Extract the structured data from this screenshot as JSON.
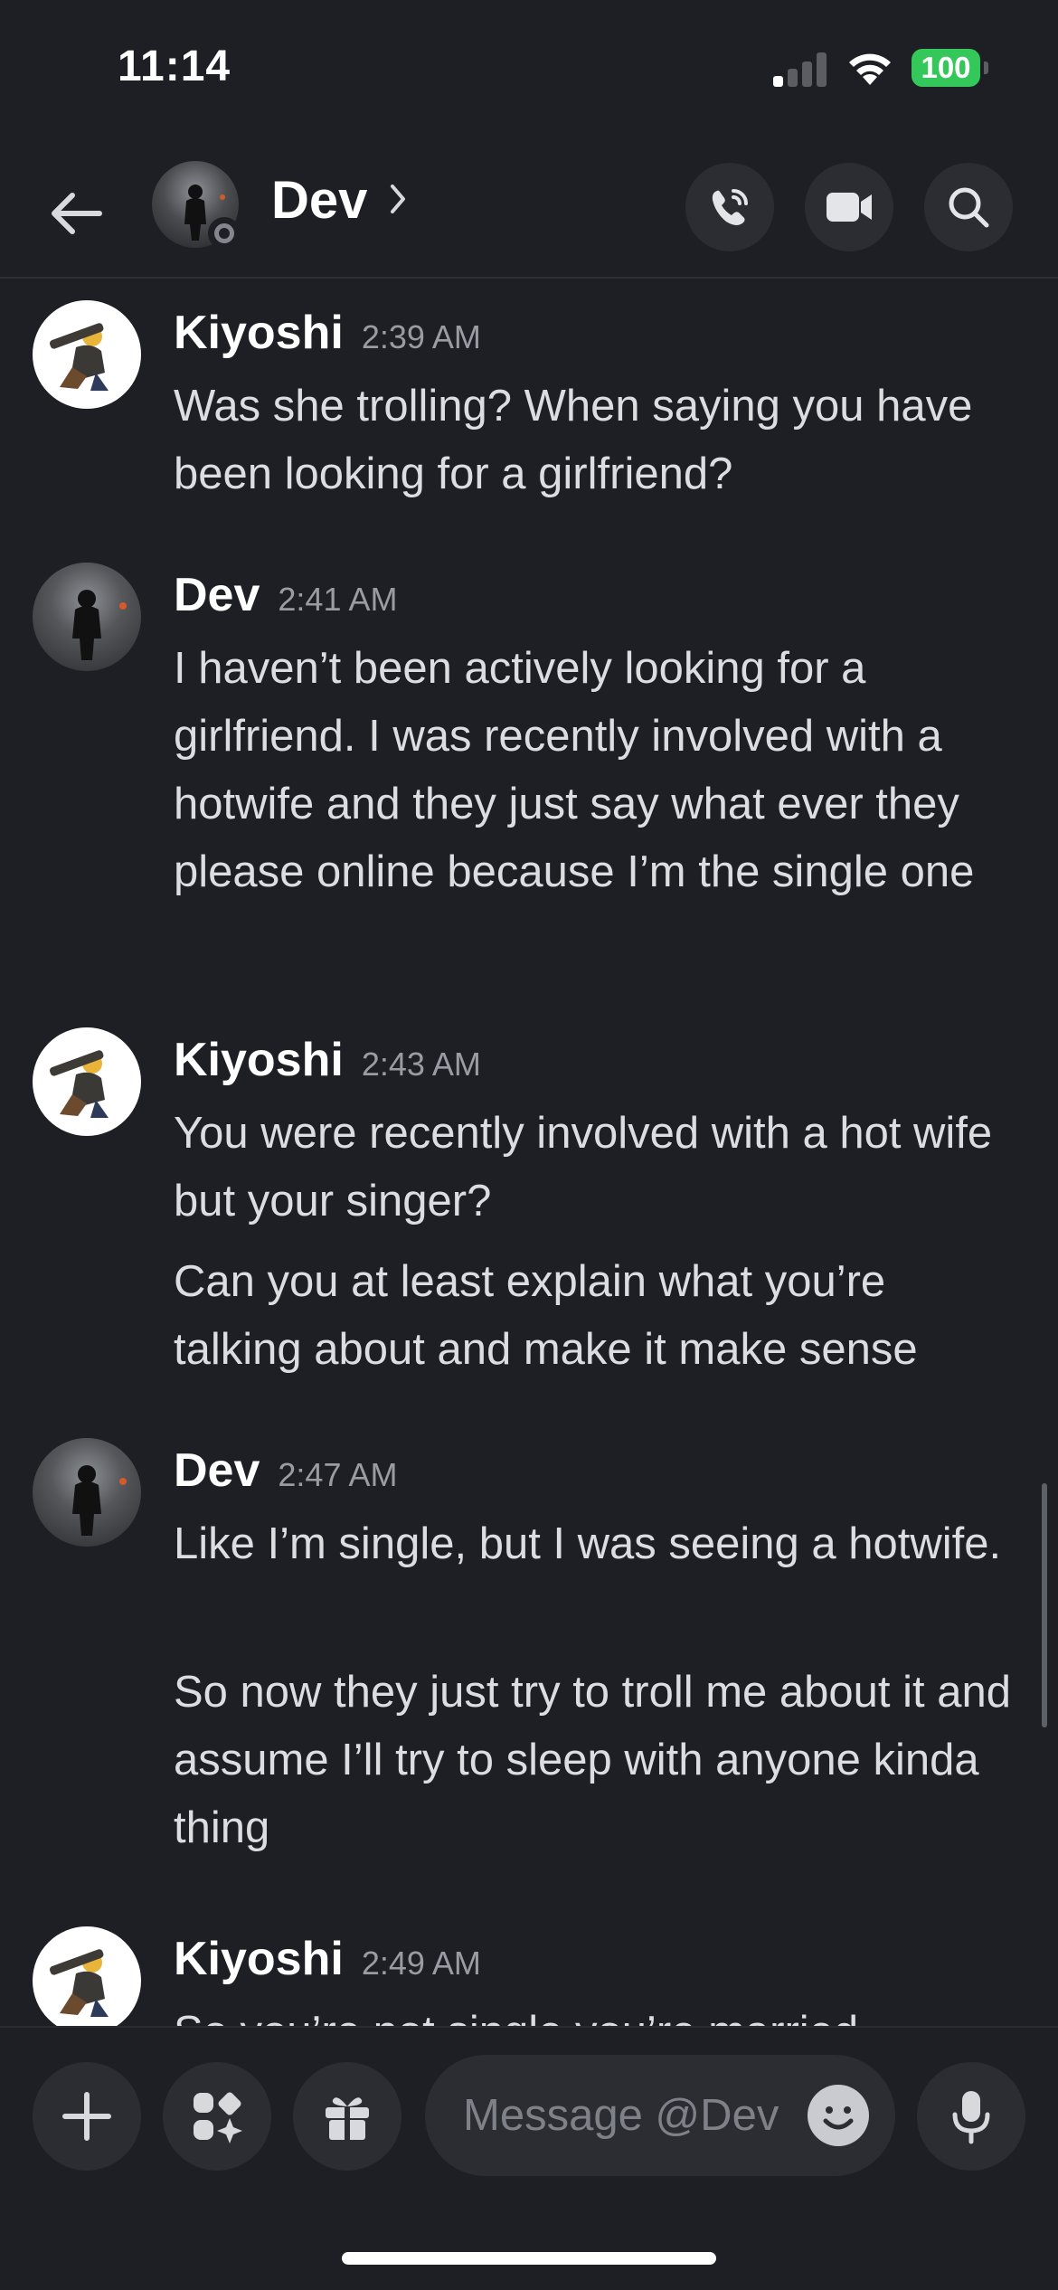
{
  "status_bar": {
    "time": "11:14",
    "battery": "100"
  },
  "header": {
    "name": "Dev"
  },
  "messages": [
    {
      "author": "Kiyoshi",
      "time": "2:39 AM",
      "lines": [
        "Was she trolling? When saying you have been looking for a girlfriend?"
      ]
    },
    {
      "author": "Dev",
      "time": "2:41 AM",
      "lines": [
        "I haven’t been actively looking for a girlfriend. I was recently involved with a hotwife and they just say what ever they please online because I’m the single one"
      ]
    },
    {
      "author": "Kiyoshi",
      "time": "2:43 AM",
      "lines": [
        "You were recently involved with a hot wife but your singer?",
        "Can you at least explain what you’re talking about and make it make sense"
      ]
    },
    {
      "author": "Dev",
      "time": "2:47 AM",
      "lines": [
        "Like I’m single, but I was seeing a hotwife.",
        "So now they just try to troll me about it and assume I’ll try to sleep with anyone kinda thing"
      ]
    },
    {
      "author": "Kiyoshi",
      "time": "2:49 AM",
      "lines": [
        "So you’re not single you’re married"
      ]
    }
  ],
  "composer": {
    "placeholder": "Message @Dev"
  },
  "icons": {
    "back": "arrow-left-icon",
    "call": "phone-call-icon",
    "video": "video-camera-icon",
    "search": "search-icon",
    "add": "plus-icon",
    "apps": "apps-sparkle-icon",
    "gift": "gift-icon",
    "emoji": "smiley-icon",
    "mic": "microphone-icon"
  },
  "colors": {
    "background": "#1e1f25",
    "battery": "#34c759",
    "button": "#2b2d33"
  }
}
